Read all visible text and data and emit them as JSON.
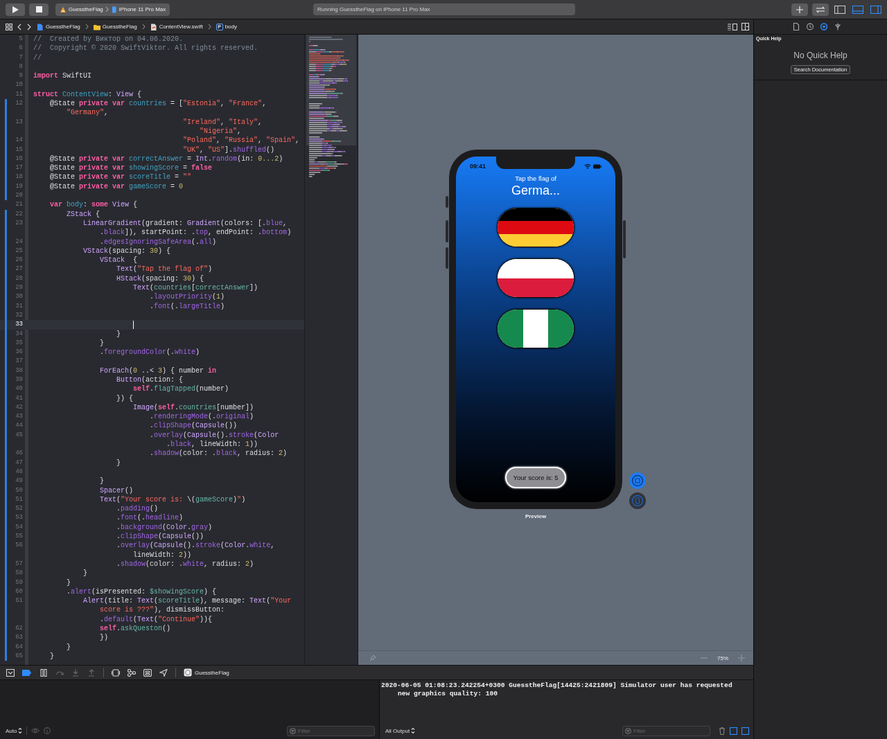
{
  "toolbar": {
    "scheme": "GuesstheFlag",
    "device": "iPhone 11 Pro Max",
    "activity": "Running GuesstheFlag on iPhone 11 Pro Max",
    "panels": [
      {
        "on": false
      },
      {
        "on": true
      },
      {
        "on": true
      }
    ]
  },
  "jump_bar": {
    "crumbs": [
      {
        "kind": "project",
        "label": "GuesstheFlag"
      },
      {
        "kind": "folder",
        "label": "GuesstheFlag"
      },
      {
        "kind": "swift",
        "label": "ContentView.swift"
      },
      {
        "kind": "property",
        "badge": "P",
        "label": "body"
      }
    ]
  },
  "inspector_tabs": [
    {
      "kind": "file",
      "selected": false
    },
    {
      "kind": "history",
      "selected": false
    },
    {
      "kind": "help",
      "selected": true
    },
    {
      "kind": "attributes",
      "selected": false
    }
  ],
  "editor": {
    "lines": [
      {
        "number": "5",
        "rows": [
          {
            "tokens": [
              {
                "kind": "comment",
                "text": "//  Created by Виктор on 04.06.2020."
              }
            ]
          }
        ]
      },
      {
        "number": "6",
        "rows": [
          {
            "tokens": [
              {
                "kind": "comment",
                "text": "//  Copyright © 2020 SwiftViktor. All rights reserved."
              }
            ]
          }
        ]
      },
      {
        "number": "7",
        "rows": [
          {
            "tokens": [
              {
                "kind": "comment",
                "text": "//"
              }
            ]
          }
        ]
      },
      {
        "number": "8"
      },
      {
        "number": "9",
        "rows": [
          {
            "tokens": [
              {
                "kind": "keyword",
                "text": "import"
              },
              {
                "kind": "plain",
                "text": " SwiftUI"
              }
            ]
          }
        ]
      },
      {
        "number": "10"
      },
      {
        "number": "11",
        "rows": [
          {
            "tokens": [
              {
                "kind": "keyword",
                "text": "struct"
              },
              {
                "kind": "decl",
                "text": " ContentView"
              },
              {
                "kind": "plain",
                "text": ": "
              },
              {
                "kind": "type",
                "text": "View"
              },
              {
                "kind": "plain",
                "text": " {"
              }
            ]
          }
        ]
      },
      {
        "number": "12",
        "changed": true,
        "rows": [
          {
            "tokens": [
              {
                "kind": "plain",
                "text": "    @State "
              },
              {
                "kind": "keyword",
                "text": "private"
              },
              {
                "kind": "keyword",
                "text": " var"
              },
              {
                "kind": "decl",
                "text": " countries"
              },
              {
                "kind": "plain",
                "text": " = ["
              },
              {
                "kind": "string",
                "text": "\"Estonia\""
              },
              {
                "kind": "plain",
                "text": ", "
              },
              {
                "kind": "string",
                "text": "\"France\""
              },
              {
                "kind": "plain",
                "text": ","
              }
            ]
          },
          {
            "tokens": [
              {
                "kind": "string",
                "text": "        \"Germany\""
              },
              {
                "kind": "plain",
                "text": ","
              }
            ]
          }
        ]
      },
      {
        "number": "13",
        "changed": true,
        "rows": [
          {
            "tokens": [
              {
                "kind": "string",
                "text": "                                    \"Ireland\""
              },
              {
                "kind": "plain",
                "text": ", "
              },
              {
                "kind": "string",
                "text": "\"Italy\""
              },
              {
                "kind": "plain",
                "text": ","
              }
            ]
          },
          {
            "tokens": [
              {
                "kind": "string",
                "text": "                                        \"Nigeria\""
              },
              {
                "kind": "plain",
                "text": ","
              }
            ]
          }
        ]
      },
      {
        "number": "14",
        "changed": true,
        "rows": [
          {
            "tokens": [
              {
                "kind": "string",
                "text": "                                    \"Poland\""
              },
              {
                "kind": "plain",
                "text": ", "
              },
              {
                "kind": "string",
                "text": "\"Russia\""
              },
              {
                "kind": "plain",
                "text": ", "
              },
              {
                "kind": "string",
                "text": "\"Spain\""
              },
              {
                "kind": "plain",
                "text": ","
              }
            ]
          }
        ]
      },
      {
        "number": "15",
        "changed": true,
        "rows": [
          {
            "tokens": [
              {
                "kind": "string",
                "text": "                                    \"UK\""
              },
              {
                "kind": "plain",
                "text": ", "
              },
              {
                "kind": "string",
                "text": "\"US\""
              },
              {
                "kind": "plain",
                "text": "]."
              },
              {
                "kind": "system",
                "text": "shuffled"
              },
              {
                "kind": "plain",
                "text": "()"
              }
            ]
          }
        ]
      },
      {
        "number": "16",
        "changed": true,
        "rows": [
          {
            "tokens": [
              {
                "kind": "plain",
                "text": "    @State "
              },
              {
                "kind": "keyword",
                "text": "private"
              },
              {
                "kind": "keyword",
                "text": " var"
              },
              {
                "kind": "decl",
                "text": " correctAnswer"
              },
              {
                "kind": "plain",
                "text": " = "
              },
              {
                "kind": "type",
                "text": "Int"
              },
              {
                "kind": "plain",
                "text": "."
              },
              {
                "kind": "system",
                "text": "random"
              },
              {
                "kind": "plain",
                "text": "(in: "
              },
              {
                "kind": "number",
                "text": "0...2"
              },
              {
                "kind": "plain",
                "text": ")"
              }
            ]
          }
        ]
      },
      {
        "number": "17",
        "changed": true,
        "rows": [
          {
            "tokens": [
              {
                "kind": "plain",
                "text": "    @State "
              },
              {
                "kind": "keyword",
                "text": "private"
              },
              {
                "kind": "keyword",
                "text": " var"
              },
              {
                "kind": "decl",
                "text": " showingScore"
              },
              {
                "kind": "plain",
                "text": " = "
              },
              {
                "kind": "keyword",
                "text": "false"
              }
            ]
          }
        ]
      },
      {
        "number": "18",
        "changed": true,
        "rows": [
          {
            "tokens": [
              {
                "kind": "plain",
                "text": "    @State "
              },
              {
                "kind": "keyword",
                "text": "private"
              },
              {
                "kind": "keyword",
                "text": " var"
              },
              {
                "kind": "decl",
                "text": " scoreTitle"
              },
              {
                "kind": "plain",
                "text": " = "
              },
              {
                "kind": "string",
                "text": "\"\""
              }
            ]
          }
        ]
      },
      {
        "number": "19",
        "changed": true,
        "rows": [
          {
            "tokens": [
              {
                "kind": "plain",
                "text": "    @State "
              },
              {
                "kind": "keyword",
                "text": "private"
              },
              {
                "kind": "keyword",
                "text": " var"
              },
              {
                "kind": "decl",
                "text": " gameScore"
              },
              {
                "kind": "plain",
                "text": " = "
              },
              {
                "kind": "number",
                "text": "0"
              }
            ]
          }
        ]
      },
      {
        "number": "20",
        "changed": true
      },
      {
        "number": "21",
        "rows": [
          {
            "tokens": [
              {
                "kind": "keyword",
                "text": "    var"
              },
              {
                "kind": "decl",
                "text": " body"
              },
              {
                "kind": "plain",
                "text": ": "
              },
              {
                "kind": "keyword",
                "text": "some"
              },
              {
                "kind": "type",
                "text": " View"
              },
              {
                "kind": "plain",
                "text": " {"
              }
            ]
          }
        ]
      },
      {
        "number": "22",
        "changed": true,
        "rows": [
          {
            "tokens": [
              {
                "kind": "type",
                "text": "        ZStack"
              },
              {
                "kind": "plain",
                "text": " {"
              }
            ]
          }
        ]
      },
      {
        "number": "23",
        "changed": true,
        "rows": [
          {
            "tokens": [
              {
                "kind": "type",
                "text": "            LinearGradient"
              },
              {
                "kind": "plain",
                "text": "(gradient: "
              },
              {
                "kind": "type",
                "text": "Gradient"
              },
              {
                "kind": "plain",
                "text": "(colors: [."
              },
              {
                "kind": "system",
                "text": "blue"
              },
              {
                "kind": "plain",
                "text": ","
              }
            ]
          },
          {
            "tokens": [
              {
                "kind": "plain",
                "text": "                ."
              },
              {
                "kind": "system",
                "text": "black"
              },
              {
                "kind": "plain",
                "text": "]), startPoint: ."
              },
              {
                "kind": "system",
                "text": "top"
              },
              {
                "kind": "plain",
                "text": ", endPoint: ."
              },
              {
                "kind": "system",
                "text": "bottom"
              },
              {
                "kind": "plain",
                "text": ")"
              }
            ]
          }
        ]
      },
      {
        "number": "24",
        "changed": true,
        "rows": [
          {
            "tokens": [
              {
                "kind": "plain",
                "text": "                ."
              },
              {
                "kind": "system",
                "text": "edgesIgnoringSafeArea"
              },
              {
                "kind": "plain",
                "text": "(."
              },
              {
                "kind": "system",
                "text": "all"
              },
              {
                "kind": "plain",
                "text": ")"
              }
            ]
          }
        ]
      },
      {
        "number": "25",
        "changed": true,
        "rows": [
          {
            "tokens": [
              {
                "kind": "type",
                "text": "            VStack"
              },
              {
                "kind": "plain",
                "text": "(spacing: "
              },
              {
                "kind": "number",
                "text": "30"
              },
              {
                "kind": "plain",
                "text": ") {"
              }
            ]
          }
        ]
      },
      {
        "number": "26",
        "changed": true,
        "rows": [
          {
            "tokens": [
              {
                "kind": "type",
                "text": "                VStack"
              },
              {
                "kind": "plain",
                "text": "  {"
              }
            ]
          }
        ]
      },
      {
        "number": "27",
        "changed": true,
        "rows": [
          {
            "tokens": [
              {
                "kind": "type",
                "text": "                    Text"
              },
              {
                "kind": "plain",
                "text": "("
              },
              {
                "kind": "string",
                "text": "\"Tap the flag of\""
              },
              {
                "kind": "plain",
                "text": ")"
              }
            ]
          }
        ]
      },
      {
        "number": "28",
        "changed": true,
        "rows": [
          {
            "tokens": [
              {
                "kind": "type",
                "text": "                    HStack"
              },
              {
                "kind": "plain",
                "text": "(spacing: "
              },
              {
                "kind": "number",
                "text": "30"
              },
              {
                "kind": "plain",
                "text": ") {"
              }
            ]
          }
        ]
      },
      {
        "number": "29",
        "changed": true,
        "rows": [
          {
            "tokens": [
              {
                "kind": "type",
                "text": "                        Text"
              },
              {
                "kind": "plain",
                "text": "("
              },
              {
                "kind": "project",
                "text": "countries"
              },
              {
                "kind": "plain",
                "text": "["
              },
              {
                "kind": "project",
                "text": "correctAnswer"
              },
              {
                "kind": "plain",
                "text": "])"
              }
            ]
          }
        ]
      },
      {
        "number": "30",
        "changed": true,
        "rows": [
          {
            "tokens": [
              {
                "kind": "plain",
                "text": "                            ."
              },
              {
                "kind": "system",
                "text": "layoutPriority"
              },
              {
                "kind": "plain",
                "text": "("
              },
              {
                "kind": "number",
                "text": "1"
              },
              {
                "kind": "plain",
                "text": ")"
              }
            ]
          }
        ]
      },
      {
        "number": "31",
        "changed": true,
        "rows": [
          {
            "tokens": [
              {
                "kind": "plain",
                "text": "                            ."
              },
              {
                "kind": "system",
                "text": "font"
              },
              {
                "kind": "plain",
                "text": "(."
              },
              {
                "kind": "system",
                "text": "largeTitle"
              },
              {
                "kind": "plain",
                "text": ")"
              }
            ]
          }
        ]
      },
      {
        "number": "32",
        "changed": true
      },
      {
        "number": "33",
        "changed": true,
        "current": true,
        "cursor": true
      },
      {
        "number": "34",
        "changed": true,
        "rows": [
          {
            "tokens": [
              {
                "kind": "plain",
                "text": "                    }"
              }
            ]
          }
        ]
      },
      {
        "number": "35",
        "changed": true,
        "rows": [
          {
            "tokens": [
              {
                "kind": "plain",
                "text": "                }"
              }
            ]
          }
        ]
      },
      {
        "number": "36",
        "changed": true,
        "rows": [
          {
            "tokens": [
              {
                "kind": "plain",
                "text": "                ."
              },
              {
                "kind": "system",
                "text": "foregroundColor"
              },
              {
                "kind": "plain",
                "text": "(."
              },
              {
                "kind": "system",
                "text": "white"
              },
              {
                "kind": "plain",
                "text": ")"
              }
            ]
          }
        ]
      },
      {
        "number": "37",
        "changed": true
      },
      {
        "number": "38",
        "changed": true,
        "rows": [
          {
            "tokens": [
              {
                "kind": "type",
                "text": "                ForEach"
              },
              {
                "kind": "plain",
                "text": "("
              },
              {
                "kind": "number",
                "text": "0"
              },
              {
                "kind": "plain",
                "text": " ..< "
              },
              {
                "kind": "number",
                "text": "3"
              },
              {
                "kind": "plain",
                "text": ") { number "
              },
              {
                "kind": "keyword",
                "text": "in"
              }
            ]
          }
        ]
      },
      {
        "number": "39",
        "changed": true,
        "rows": [
          {
            "tokens": [
              {
                "kind": "type",
                "text": "                    Button"
              },
              {
                "kind": "plain",
                "text": "(action: {"
              }
            ]
          }
        ]
      },
      {
        "number": "40",
        "changed": true,
        "rows": [
          {
            "tokens": [
              {
                "kind": "keyword",
                "text": "                        self"
              },
              {
                "kind": "plain",
                "text": "."
              },
              {
                "kind": "project",
                "text": "flagTapped"
              },
              {
                "kind": "plain",
                "text": "(number)"
              }
            ]
          }
        ]
      },
      {
        "number": "41",
        "changed": true,
        "rows": [
          {
            "tokens": [
              {
                "kind": "plain",
                "text": "                    }) {"
              }
            ]
          }
        ]
      },
      {
        "number": "42",
        "changed": true,
        "rows": [
          {
            "tokens": [
              {
                "kind": "type",
                "text": "                        Image"
              },
              {
                "kind": "plain",
                "text": "("
              },
              {
                "kind": "keyword",
                "text": "self"
              },
              {
                "kind": "plain",
                "text": "."
              },
              {
                "kind": "project",
                "text": "countries"
              },
              {
                "kind": "plain",
                "text": "[number])"
              }
            ]
          }
        ]
      },
      {
        "number": "43",
        "changed": true,
        "rows": [
          {
            "tokens": [
              {
                "kind": "plain",
                "text": "                            ."
              },
              {
                "kind": "system",
                "text": "renderingMode"
              },
              {
                "kind": "plain",
                "text": "(."
              },
              {
                "kind": "system",
                "text": "original"
              },
              {
                "kind": "plain",
                "text": ")"
              }
            ]
          }
        ]
      },
      {
        "number": "44",
        "changed": true,
        "rows": [
          {
            "tokens": [
              {
                "kind": "plain",
                "text": "                            ."
              },
              {
                "kind": "system",
                "text": "clipShape"
              },
              {
                "kind": "plain",
                "text": "("
              },
              {
                "kind": "type",
                "text": "Capsule"
              },
              {
                "kind": "plain",
                "text": "())"
              }
            ]
          }
        ]
      },
      {
        "number": "45",
        "changed": true,
        "rows": [
          {
            "tokens": [
              {
                "kind": "plain",
                "text": "                            ."
              },
              {
                "kind": "system",
                "text": "overlay"
              },
              {
                "kind": "plain",
                "text": "("
              },
              {
                "kind": "type",
                "text": "Capsule"
              },
              {
                "kind": "plain",
                "text": "()."
              },
              {
                "kind": "system",
                "text": "stroke"
              },
              {
                "kind": "plain",
                "text": "("
              },
              {
                "kind": "type",
                "text": "Color"
              }
            ]
          },
          {
            "tokens": [
              {
                "kind": "plain",
                "text": "                                ."
              },
              {
                "kind": "system",
                "text": "black"
              },
              {
                "kind": "plain",
                "text": ", lineWidth: "
              },
              {
                "kind": "number",
                "text": "1"
              },
              {
                "kind": "plain",
                "text": "))"
              }
            ]
          }
        ]
      },
      {
        "number": "46",
        "changed": true,
        "rows": [
          {
            "tokens": [
              {
                "kind": "plain",
                "text": "                            ."
              },
              {
                "kind": "system",
                "text": "shadow"
              },
              {
                "kind": "plain",
                "text": "(color: ."
              },
              {
                "kind": "system",
                "text": "black"
              },
              {
                "kind": "plain",
                "text": ", radius: "
              },
              {
                "kind": "number",
                "text": "2"
              },
              {
                "kind": "plain",
                "text": ")"
              }
            ]
          }
        ]
      },
      {
        "number": "47",
        "changed": true,
        "rows": [
          {
            "tokens": [
              {
                "kind": "plain",
                "text": "                    }"
              }
            ]
          }
        ]
      },
      {
        "number": "48",
        "changed": true
      },
      {
        "number": "49",
        "changed": true,
        "rows": [
          {
            "tokens": [
              {
                "kind": "plain",
                "text": "                }"
              }
            ]
          }
        ]
      },
      {
        "number": "50",
        "changed": true,
        "rows": [
          {
            "tokens": [
              {
                "kind": "type",
                "text": "                Spacer"
              },
              {
                "kind": "plain",
                "text": "()"
              }
            ]
          }
        ]
      },
      {
        "number": "51",
        "changed": true,
        "rows": [
          {
            "tokens": [
              {
                "kind": "type",
                "text": "                Text"
              },
              {
                "kind": "plain",
                "text": "("
              },
              {
                "kind": "string",
                "text": "\"Your score is: "
              },
              {
                "kind": "plain",
                "text": "\\("
              },
              {
                "kind": "project",
                "text": "gameScore"
              },
              {
                "kind": "plain",
                "text": ")"
              },
              {
                "kind": "string",
                "text": "\""
              },
              {
                "kind": "plain",
                "text": ")"
              }
            ]
          }
        ]
      },
      {
        "number": "52",
        "changed": true,
        "rows": [
          {
            "tokens": [
              {
                "kind": "plain",
                "text": "                    ."
              },
              {
                "kind": "system",
                "text": "padding"
              },
              {
                "kind": "plain",
                "text": "()"
              }
            ]
          }
        ]
      },
      {
        "number": "53",
        "changed": true,
        "rows": [
          {
            "tokens": [
              {
                "kind": "plain",
                "text": "                    ."
              },
              {
                "kind": "system",
                "text": "font"
              },
              {
                "kind": "plain",
                "text": "(."
              },
              {
                "kind": "system",
                "text": "headline"
              },
              {
                "kind": "plain",
                "text": ")"
              }
            ]
          }
        ]
      },
      {
        "number": "54",
        "changed": true,
        "rows": [
          {
            "tokens": [
              {
                "kind": "plain",
                "text": "                    ."
              },
              {
                "kind": "system",
                "text": "background"
              },
              {
                "kind": "plain",
                "text": "("
              },
              {
                "kind": "type",
                "text": "Color"
              },
              {
                "kind": "plain",
                "text": "."
              },
              {
                "kind": "system",
                "text": "gray"
              },
              {
                "kind": "plain",
                "text": ")"
              }
            ]
          }
        ]
      },
      {
        "number": "55",
        "changed": true,
        "rows": [
          {
            "tokens": [
              {
                "kind": "plain",
                "text": "                    ."
              },
              {
                "kind": "system",
                "text": "clipShape"
              },
              {
                "kind": "plain",
                "text": "("
              },
              {
                "kind": "type",
                "text": "Capsule"
              },
              {
                "kind": "plain",
                "text": "())"
              }
            ]
          }
        ]
      },
      {
        "number": "56",
        "changed": true,
        "rows": [
          {
            "tokens": [
              {
                "kind": "plain",
                "text": "                    ."
              },
              {
                "kind": "system",
                "text": "overlay"
              },
              {
                "kind": "plain",
                "text": "("
              },
              {
                "kind": "type",
                "text": "Capsule"
              },
              {
                "kind": "plain",
                "text": "()."
              },
              {
                "kind": "system",
                "text": "stroke"
              },
              {
                "kind": "plain",
                "text": "("
              },
              {
                "kind": "type",
                "text": "Color"
              },
              {
                "kind": "plain",
                "text": "."
              },
              {
                "kind": "system",
                "text": "white"
              },
              {
                "kind": "plain",
                "text": ","
              }
            ]
          },
          {
            "tokens": [
              {
                "kind": "plain",
                "text": "                        lineWidth: "
              },
              {
                "kind": "number",
                "text": "2"
              },
              {
                "kind": "plain",
                "text": "))"
              }
            ]
          }
        ]
      },
      {
        "number": "57",
        "changed": true,
        "rows": [
          {
            "tokens": [
              {
                "kind": "plain",
                "text": "                    ."
              },
              {
                "kind": "system",
                "text": "shadow"
              },
              {
                "kind": "plain",
                "text": "(color: ."
              },
              {
                "kind": "system",
                "text": "white"
              },
              {
                "kind": "plain",
                "text": ", radius: "
              },
              {
                "kind": "number",
                "text": "2"
              },
              {
                "kind": "plain",
                "text": ")"
              }
            ]
          }
        ]
      },
      {
        "number": "58",
        "changed": true,
        "rows": [
          {
            "tokens": [
              {
                "kind": "plain",
                "text": "            }"
              }
            ]
          }
        ]
      },
      {
        "number": "59",
        "changed": true,
        "rows": [
          {
            "tokens": [
              {
                "kind": "plain",
                "text": "        }"
              }
            ]
          }
        ]
      },
      {
        "number": "60",
        "changed": true,
        "rows": [
          {
            "tokens": [
              {
                "kind": "plain",
                "text": "        ."
              },
              {
                "kind": "system",
                "text": "alert"
              },
              {
                "kind": "plain",
                "text": "(isPresented: "
              },
              {
                "kind": "project",
                "text": "$showingScore"
              },
              {
                "kind": "plain",
                "text": ") {"
              }
            ]
          }
        ]
      },
      {
        "number": "61",
        "changed": true,
        "rows": [
          {
            "tokens": [
              {
                "kind": "type",
                "text": "            Alert"
              },
              {
                "kind": "plain",
                "text": "(title: "
              },
              {
                "kind": "type",
                "text": "Text"
              },
              {
                "kind": "plain",
                "text": "("
              },
              {
                "kind": "project",
                "text": "scoreTitle"
              },
              {
                "kind": "plain",
                "text": "), message: "
              },
              {
                "kind": "type",
                "text": "Text"
              },
              {
                "kind": "plain",
                "text": "("
              },
              {
                "kind": "string",
                "text": "\"Your"
              }
            ]
          },
          {
            "tokens": [
              {
                "kind": "string",
                "text": "                score is ???\""
              },
              {
                "kind": "plain",
                "text": "), dismissButton:"
              }
            ]
          },
          {
            "tokens": [
              {
                "kind": "plain",
                "text": "                ."
              },
              {
                "kind": "system",
                "text": "default"
              },
              {
                "kind": "plain",
                "text": "("
              },
              {
                "kind": "type",
                "text": "Text"
              },
              {
                "kind": "plain",
                "text": "("
              },
              {
                "kind": "string",
                "text": "\"Continue\""
              },
              {
                "kind": "plain",
                "text": ")){"
              }
            ]
          }
        ]
      },
      {
        "number": "62",
        "changed": true,
        "rows": [
          {
            "tokens": [
              {
                "kind": "keyword",
                "text": "                self"
              },
              {
                "kind": "plain",
                "text": "."
              },
              {
                "kind": "project",
                "text": "askQueston"
              },
              {
                "kind": "plain",
                "text": "()"
              }
            ]
          }
        ]
      },
      {
        "number": "63",
        "changed": true,
        "rows": [
          {
            "tokens": [
              {
                "kind": "plain",
                "text": "                })"
              }
            ]
          }
        ]
      },
      {
        "number": "64",
        "changed": true,
        "rows": [
          {
            "tokens": [
              {
                "kind": "plain",
                "text": "        }"
              }
            ]
          }
        ]
      },
      {
        "number": "65",
        "changed": true,
        "rows": [
          {
            "tokens": [
              {
                "kind": "plain",
                "text": "    }"
              }
            ]
          }
        ]
      }
    ]
  },
  "canvas": {
    "preview": {
      "time": "09:41",
      "prompt": "Tap the flag of",
      "country": "Germa...",
      "flags": [
        {
          "kind": "horizontal",
          "stripes": [
            {
              "color": "#000000"
            },
            {
              "color": "#dd0a12"
            },
            {
              "color": "#ffcc33"
            }
          ]
        },
        {
          "kind": "horizontal",
          "stripes": [
            {
              "color": "#ffffff"
            },
            {
              "color": "#dc1c3c"
            }
          ]
        },
        {
          "kind": "vertical",
          "stripes": [
            {
              "color": "#168a4e"
            },
            {
              "color": "#ffffff"
            },
            {
              "color": "#168a4e"
            }
          ]
        }
      ],
      "score": "Your score is: 5"
    },
    "caption": "Preview",
    "live": true,
    "zoom": "75%"
  },
  "quick_help": {
    "title": "Quick Help",
    "message": "No Quick Help",
    "button": "Search Documentation"
  },
  "debug_bar": {
    "breakpoints_active": true,
    "process": "GuesstheFlag"
  },
  "variables": {
    "scope": "Auto",
    "filter_placeholder": "Filter"
  },
  "console": {
    "lines": [
      "2020-06-05 01:08:23.242254+0300 GuesstheFlag[14425:2421809] Simulator user has requested new graphics quality: 100"
    ],
    "output": "All Output",
    "filter_placeholder": "Filter"
  }
}
